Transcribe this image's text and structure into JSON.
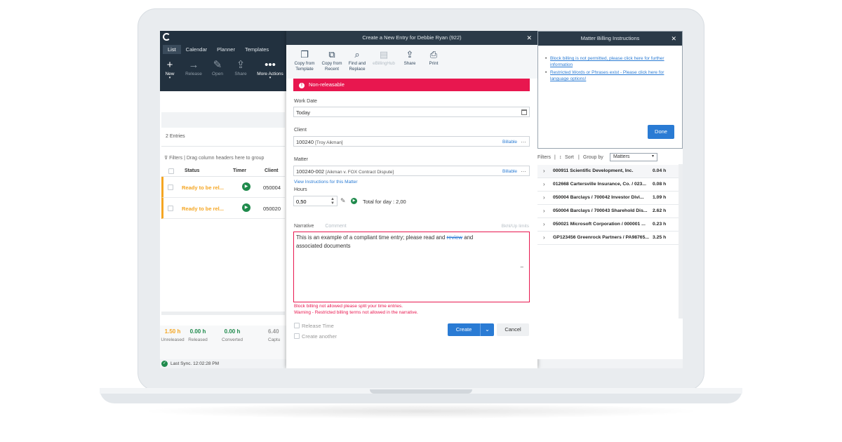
{
  "left": {
    "tabs": [
      "List",
      "Calendar",
      "Planner",
      "Templates"
    ],
    "toolbar": [
      {
        "label": "New",
        "icon": "plus-icon"
      },
      {
        "label": "Release",
        "icon": "arrow-right-icon"
      },
      {
        "label": "Open",
        "icon": "pencil-icon"
      },
      {
        "label": "Share",
        "icon": "share-icon"
      },
      {
        "label": "More Actions",
        "icon": "more-icon"
      }
    ],
    "entries_count": "2 Entries",
    "filters_text": "Filters",
    "drag_hint": "Drag column headers here to group",
    "columns": {
      "status": "Status",
      "timer": "Timer",
      "client": "Client"
    },
    "rows": [
      {
        "status": "Ready to be rel...",
        "client": "050004"
      },
      {
        "status": "Ready to be rel...",
        "client": "050020"
      }
    ],
    "totals": [
      {
        "value": "1.50 h",
        "label": "Unreleased"
      },
      {
        "value": "0.00 h",
        "label": "Released"
      },
      {
        "value": "0.00 h",
        "label": "Converted"
      },
      {
        "value": "6.40",
        "label": "Captu"
      }
    ],
    "last_sync": "Last Sync. 12:02:28 PM"
  },
  "modal": {
    "title": "Create a New Entry for Debbie Ryan (922)",
    "toolbar": [
      {
        "line1": "Copy from",
        "line2": "Template",
        "icon": "copy-icon"
      },
      {
        "line1": "Copy from",
        "line2": "Recent",
        "icon": "recent-copy-icon"
      },
      {
        "line1": "Find and",
        "line2": "Replace",
        "icon": "search-icon"
      },
      {
        "line1": "eBillingHub",
        "line2": "",
        "icon": "ebilling-icon"
      },
      {
        "line1": "Share",
        "line2": "",
        "icon": "share-icon"
      },
      {
        "line1": "Print",
        "line2": "",
        "icon": "print-icon"
      }
    ],
    "banner": "Non-releasable",
    "work_date_label": "Work Date",
    "work_date_value": "Today",
    "client_label": "Client",
    "client_code": "100240",
    "client_name": "[Troy Aikman]",
    "client_billable": "Billable",
    "matter_label": "Matter",
    "matter_code": "100240-002",
    "matter_name": "[Aikman v. FOX Contract Dispute]",
    "matter_billable": "Billable",
    "view_instructions": "View Instructions for this Matter",
    "hours_label": "Hours",
    "hours_value": "0,50",
    "total_for_day": "Total for day : 2,00",
    "narrative_tab": "Narrative",
    "comment_tab": "Comment",
    "narrative_right": "Bkhl/Up limits",
    "narrative_text_1": "This is an example of a compliant time entry; please read and ",
    "narrative_strike": "review",
    "narrative_text_2": " and",
    "narrative_text_3": "associated documents",
    "error_1": "Block billing not allowed please split your time entries.",
    "error_2": "Warning - Restricted billing terms not allowed in the narrative.",
    "release_time": "Release Time",
    "create_another": "Create another",
    "create_label": "Create",
    "cancel_label": "Cancel"
  },
  "right": {
    "title": "Matter Billing Instructions",
    "instructions": [
      "Block billing is not permitted, please click here for further information",
      "Restricted Words or Phrases exist - Please click here for language options!"
    ],
    "done_label": "Done",
    "filters": "Filters",
    "sort": "Sort",
    "group_by": "Group by",
    "group_value": "Matters",
    "matters": [
      {
        "name": "000911 Scientific Development, Inc.",
        "hours": "0.04 h"
      },
      {
        "name": "012668 Cartersville Insurance, Co. / 023...",
        "hours": "0.08 h"
      },
      {
        "name": "050004 Barclays / 700042 Investor Divi...",
        "hours": "1.09 h"
      },
      {
        "name": "050004 Barclays / 700043 Sharehold Dis...",
        "hours": "2.62 h"
      },
      {
        "name": "050021 Microsoft Corporation / 000001 ...",
        "hours": "0.23 h"
      },
      {
        "name": "GP123456 Greenrock Partners / PA98765...",
        "hours": "3.25 h"
      }
    ]
  },
  "colors": {
    "accent": "#2a7bd4",
    "error": "#e8174f",
    "success": "#1f8a4c",
    "warning": "#f5a623",
    "header": "#22313f"
  }
}
